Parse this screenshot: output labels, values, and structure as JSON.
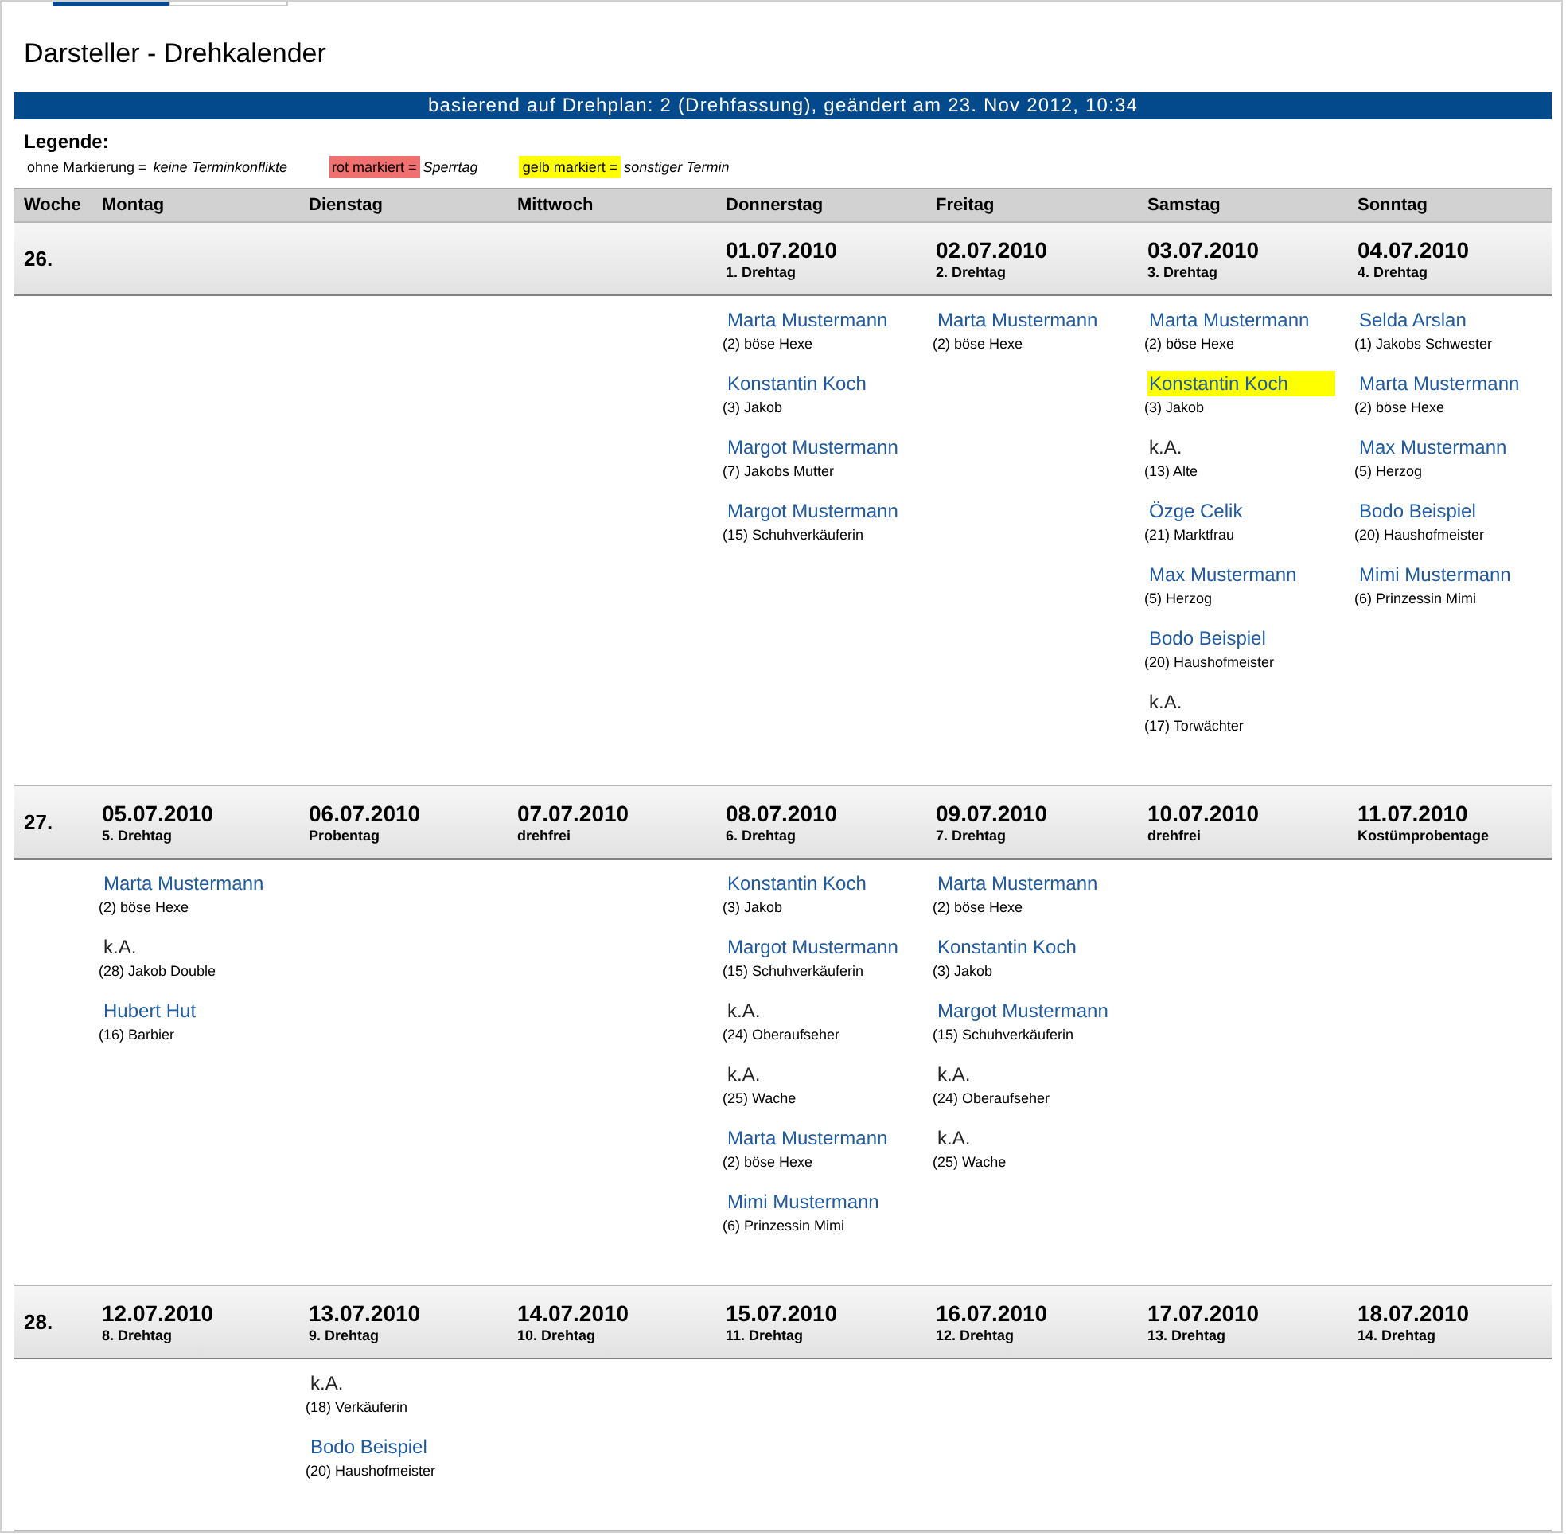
{
  "tabs": [
    {
      "selected": true
    },
    {
      "selected": false
    }
  ],
  "title": "Darsteller - Drehkalender",
  "banner": "basierend auf Drehplan: 2 (Drehfassung), geändert am 23. Nov 2012, 10:34",
  "legend": {
    "heading": "Legende:",
    "items": [
      {
        "label": "ohne Markierung =",
        "meaning": "keine Terminkonflikte"
      },
      {
        "label": "rot markiert =",
        "meaning": "Sperrtag",
        "color": "#f07070"
      },
      {
        "label": "gelb markiert =",
        "meaning": "sonstiger Termin",
        "color": "#ffff00"
      }
    ]
  },
  "columns": [
    "Woche",
    "Montag",
    "Dienstag",
    "Mittwoch",
    "Donnerstag",
    "Freitag",
    "Samstag",
    "Sonntag"
  ],
  "weeks": [
    {
      "week": "26.",
      "days": [
        {
          "kind": "blank"
        },
        {
          "kind": "blank"
        },
        {
          "kind": "blank"
        },
        {
          "kind": "day",
          "date": "01.07.2010",
          "note": "1. Drehtag",
          "entries": [
            {
              "kind": "actor",
              "name": "Marta Mustermann",
              "role": "(2) böse Hexe"
            },
            {
              "kind": "actor",
              "name": "Konstantin Koch",
              "role": "(3) Jakob"
            },
            {
              "kind": "actor",
              "name": "Margot Mustermann",
              "role": "(7) Jakobs Mutter"
            },
            {
              "kind": "actor",
              "name": "Margot Mustermann",
              "role": "(15) Schuhverkäuferin"
            }
          ]
        },
        {
          "kind": "day",
          "date": "02.07.2010",
          "note": "2. Drehtag",
          "entries": [
            {
              "kind": "actor",
              "name": "Marta Mustermann",
              "role": "(2) böse Hexe"
            }
          ]
        },
        {
          "kind": "day",
          "date": "03.07.2010",
          "note": "3. Drehtag",
          "entries": [
            {
              "kind": "actor",
              "name": "Marta Mustermann",
              "role": "(2) böse Hexe"
            },
            {
              "kind": "actor",
              "name": "Konstantin Koch",
              "role": "(3) Jakob",
              "color": "#ffff00"
            },
            {
              "kind": "unknown",
              "name": "k.A.",
              "role": "(13) Alte"
            },
            {
              "kind": "actor",
              "name": "Özge Celik",
              "role": "(21) Marktfrau"
            },
            {
              "kind": "actor",
              "name": "Max Mustermann",
              "role": "(5) Herzog"
            },
            {
              "kind": "actor",
              "name": "Bodo Beispiel",
              "role": "(20) Haushofmeister"
            },
            {
              "kind": "unknown",
              "name": "k.A.",
              "role": "(17) Torwächter"
            }
          ]
        },
        {
          "kind": "day",
          "date": "04.07.2010",
          "note": "4. Drehtag",
          "entries": [
            {
              "kind": "actor",
              "name": "Selda Arslan",
              "role": "(1) Jakobs Schwester"
            },
            {
              "kind": "actor",
              "name": "Marta Mustermann",
              "role": "(2) böse Hexe"
            },
            {
              "kind": "actor",
              "name": "Max Mustermann",
              "role": "(5) Herzog"
            },
            {
              "kind": "actor",
              "name": "Bodo Beispiel",
              "role": "(20) Haushofmeister"
            },
            {
              "kind": "actor",
              "name": "Mimi Mustermann",
              "role": "(6) Prinzessin Mimi"
            }
          ]
        }
      ]
    },
    {
      "week": "27.",
      "days": [
        {
          "kind": "day",
          "date": "05.07.2010",
          "note": "5. Drehtag",
          "entries": [
            {
              "kind": "actor",
              "name": "Marta Mustermann",
              "role": "(2) böse Hexe"
            },
            {
              "kind": "unknown",
              "name": "k.A.",
              "role": "(28) Jakob Double"
            },
            {
              "kind": "actor",
              "name": "Hubert Hut",
              "role": "(16) Barbier"
            }
          ]
        },
        {
          "kind": "day",
          "date": "06.07.2010",
          "note": "Probentag"
        },
        {
          "kind": "day",
          "date": "07.07.2010",
          "note": "drehfrei"
        },
        {
          "kind": "day",
          "date": "08.07.2010",
          "note": "6. Drehtag",
          "entries": [
            {
              "kind": "actor",
              "name": "Konstantin Koch",
              "role": "(3) Jakob"
            },
            {
              "kind": "actor",
              "name": "Margot Mustermann",
              "role": "(15) Schuhverkäuferin"
            },
            {
              "kind": "unknown",
              "name": "k.A.",
              "role": "(24) Oberaufseher"
            },
            {
              "kind": "unknown",
              "name": "k.A.",
              "role": "(25) Wache"
            },
            {
              "kind": "actor",
              "name": "Marta Mustermann",
              "role": "(2) böse Hexe"
            },
            {
              "kind": "actor",
              "name": "Mimi Mustermann",
              "role": "(6) Prinzessin Mimi"
            }
          ]
        },
        {
          "kind": "day",
          "date": "09.07.2010",
          "note": "7. Drehtag",
          "entries": [
            {
              "kind": "actor",
              "name": "Marta Mustermann",
              "role": "(2) böse Hexe"
            },
            {
              "kind": "actor",
              "name": "Konstantin Koch",
              "role": "(3) Jakob"
            },
            {
              "kind": "actor",
              "name": "Margot Mustermann",
              "role": "(15) Schuhverkäuferin"
            },
            {
              "kind": "unknown",
              "name": "k.A.",
              "role": "(24) Oberaufseher"
            },
            {
              "kind": "unknown",
              "name": "k.A.",
              "role": "(25) Wache"
            }
          ]
        },
        {
          "kind": "day",
          "date": "10.07.2010",
          "note": "drehfrei"
        },
        {
          "kind": "day",
          "date": "11.07.2010",
          "note": "Kostümprobentage"
        }
      ]
    },
    {
      "week": "28.",
      "days": [
        {
          "kind": "day",
          "date": "12.07.2010",
          "note": "8. Drehtag"
        },
        {
          "kind": "day",
          "date": "13.07.2010",
          "note": "9. Drehtag",
          "entries": [
            {
              "kind": "unknown",
              "name": "k.A.",
              "role": "(18) Verkäuferin"
            },
            {
              "kind": "actor",
              "name": "Bodo Beispiel",
              "role": "(20) Haushofmeister"
            }
          ]
        },
        {
          "kind": "day",
          "date": "14.07.2010",
          "note": "10. Drehtag"
        },
        {
          "kind": "day",
          "date": "15.07.2010",
          "note": "11. Drehtag"
        },
        {
          "kind": "day",
          "date": "16.07.2010",
          "note": "12. Drehtag"
        },
        {
          "kind": "day",
          "date": "17.07.2010",
          "note": "13. Drehtag"
        },
        {
          "kind": "day",
          "date": "18.07.2010",
          "note": "14. Drehtag"
        }
      ]
    }
  ]
}
